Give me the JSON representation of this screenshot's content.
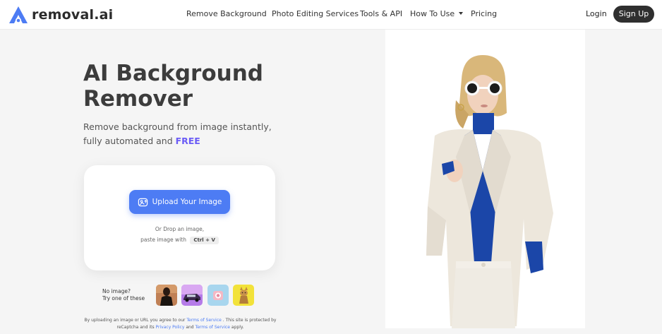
{
  "header": {
    "logo_text": "removal.ai",
    "nav": [
      {
        "label": "Remove Background"
      },
      {
        "label": "Photo Editing Services"
      },
      {
        "label": "Tools & API"
      },
      {
        "label": "How To Use"
      },
      {
        "label": "Pricing"
      }
    ],
    "login_label": "Login",
    "signup_label": "Sign Up"
  },
  "hero": {
    "title_line1": "AI Background",
    "title_line2": "Remover",
    "subtitle_part1": "Remove background from image instantly,",
    "subtitle_part2": "fully automated and",
    "subtitle_free": "FREE"
  },
  "upload": {
    "button_label": "Upload Your Image",
    "drop_line1": "Or Drop an image,",
    "drop_line2": "paste image with",
    "shortcut": "Ctrl + V"
  },
  "samples": {
    "prompt_line1": "No image?",
    "prompt_line2": "Try one of these",
    "items": [
      "person-sample",
      "car-sample",
      "product-sample",
      "animal-sample"
    ]
  },
  "legal": {
    "text1": "By uploading an image or URL you agree to our",
    "terms_link": "Terms of Service",
    "text2": ". This site is protected by reCaptcha and its",
    "privacy_link": "Privacy Policy",
    "text3": "and",
    "terms_link2": "Terms of Service",
    "text4": "apply."
  },
  "colors": {
    "accent": "#4d7cf4",
    "free": "#6b5cf6",
    "signup_bg": "#2f2f2f"
  }
}
